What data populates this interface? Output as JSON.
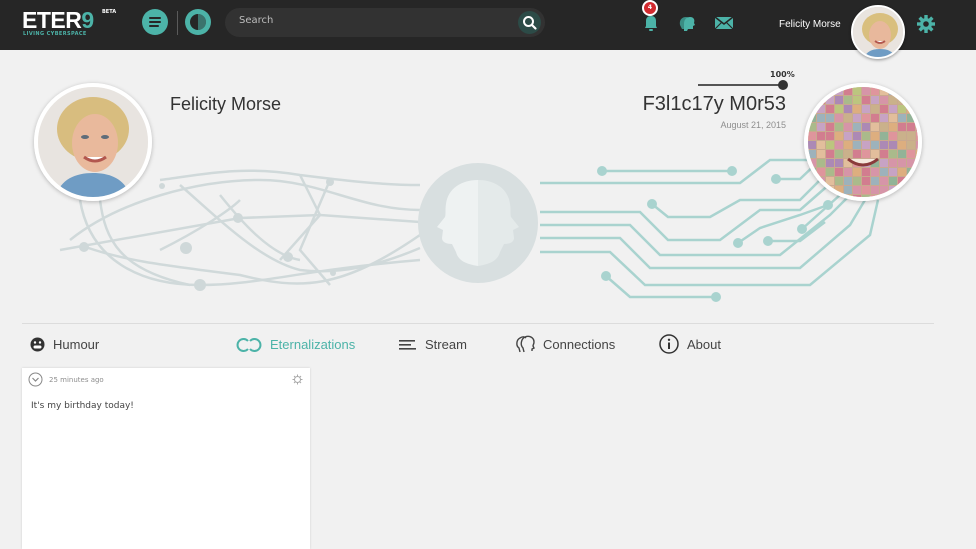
{
  "app": {
    "logo_text": "ETER",
    "logo_nine": "9",
    "logo_beta": "BETA",
    "logo_tagline": "LIVING CYBERSPACE"
  },
  "header": {
    "search_placeholder": "Search",
    "notification_count": "4",
    "user_name": "Felicity Morse"
  },
  "profile": {
    "name": "Felicity Morse",
    "counterpart_name": "F3l1c17y M0r53",
    "counterpart_date": "August 21, 2015",
    "progress_label": "100%",
    "progress_value": 1.0
  },
  "tabs": [
    {
      "label": "Humour",
      "icon": "grin-face-icon",
      "active": false
    },
    {
      "label": "Eternalizations",
      "icon": "infinity-loop-icon",
      "active": true
    },
    {
      "label": "Stream",
      "icon": "stream-lines-icon",
      "active": false
    },
    {
      "label": "Connections",
      "icon": "heads-icon",
      "active": false
    },
    {
      "label": "About",
      "icon": "info-icon",
      "active": false
    }
  ],
  "posts": [
    {
      "time": "25 minutes ago",
      "text": "It's my birthday today!"
    }
  ],
  "colors": {
    "accent": "#4cb3a8",
    "topbar": "#262626",
    "badge": "#d22a2f",
    "background": "#f1f1f1"
  }
}
